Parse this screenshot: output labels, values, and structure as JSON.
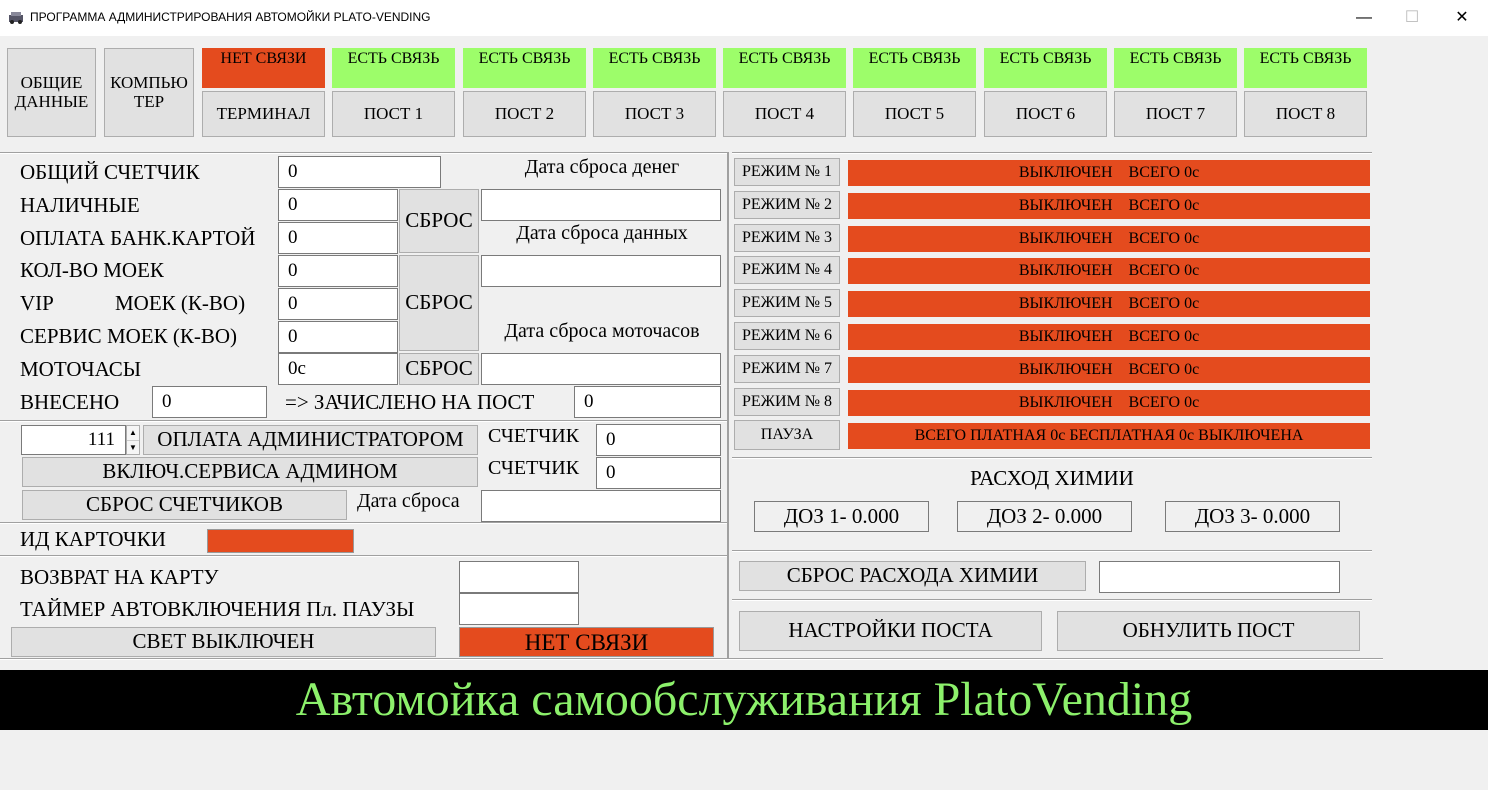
{
  "window": {
    "title": "ПРОГРАММА АДМИНИСТРИРОВАНИЯ АВТОМОЙКИ PLATO-VENDING",
    "minimize": "—",
    "maximize": "☐",
    "close": "✕"
  },
  "top_tabs": {
    "general_line1": "ОБЩИЕ",
    "general_line2": "ДАННЫЕ",
    "computer_line1": "КОМПЬЮ",
    "computer_line2": "ТЕР",
    "units": [
      {
        "status": "НЕТ СВЯЗИ",
        "status_color": "#e44b1e",
        "label": "ТЕРМИНАЛ"
      },
      {
        "status": "ЕСТЬ СВЯЗЬ",
        "status_color": "#9dfd6a",
        "label": "ПОСТ 1"
      },
      {
        "status": "ЕСТЬ СВЯЗЬ",
        "status_color": "#9dfd6a",
        "label": "ПОСТ 2"
      },
      {
        "status": "ЕСТЬ СВЯЗЬ",
        "status_color": "#9dfd6a",
        "label": "ПОСТ 3"
      },
      {
        "status": "ЕСТЬ СВЯЗЬ",
        "status_color": "#9dfd6a",
        "label": "ПОСТ 4"
      },
      {
        "status": "ЕСТЬ СВЯЗЬ",
        "status_color": "#9dfd6a",
        "label": "ПОСТ 5"
      },
      {
        "status": "ЕСТЬ СВЯЗЬ",
        "status_color": "#9dfd6a",
        "label": "ПОСТ 6"
      },
      {
        "status": "ЕСТЬ СВЯЗЬ",
        "status_color": "#9dfd6a",
        "label": "ПОСТ 7"
      },
      {
        "status": "ЕСТЬ СВЯЗЬ",
        "status_color": "#9dfd6a",
        "label": "ПОСТ 8"
      }
    ]
  },
  "counters": {
    "total_label": "ОБЩИЙ СЧЕТЧИК",
    "total_value": "0",
    "cash_label": "НАЛИЧНЫЕ",
    "cash_value": "0",
    "card_label": "ОПЛАТА БАНК.КАРТОЙ",
    "card_value": "0",
    "washes_label": "КОЛ-ВО МОЕК",
    "washes_value": "0",
    "vip_label": "VIP",
    "vip_label2": "МОЕК (К-ВО)",
    "vip_value": "0",
    "service_label": "СЕРВИС МОЕК (К-ВО)",
    "service_value": "0",
    "motohours_label": "МОТОЧАСЫ",
    "motohours_value": "0с",
    "deposited_label": "ВНЕСЕНО",
    "deposited_value": "0",
    "credited_label": "=> ЗАЧИСЛЕНО НА ПОСТ",
    "credited_value": "0",
    "reset_label": "СБРОС",
    "money_reset_date_label": "Дата сброса денег",
    "money_reset_date": "",
    "data_reset_date_label": "Дата сброса данных",
    "data_reset_date": "",
    "motohours_reset_date_label": "Дата сброса моточасов",
    "motohours_reset_date": ""
  },
  "admin": {
    "spinner_value": "111",
    "admin_pay_label": "ОПЛАТА АДМИНИСТРАТОРОМ",
    "service_enable_label": "ВКЛЮЧ.СЕРВИСА АДМИНОМ",
    "reset_counters_label": "СБРОС СЧЕТЧИКОВ",
    "counter_label": "СЧЕТЧИК",
    "counter1_value": "0",
    "counter2_value": "0",
    "reset_date_label": "Дата сброса",
    "reset_date": ""
  },
  "card": {
    "id_label": "ИД КАРТОЧКИ",
    "id_value": ""
  },
  "misc": {
    "refund_label": "ВОЗВРАТ НА КАРТУ",
    "refund_value": "",
    "timer_label": "ТАЙМЕР АВТОВКЛЮЧЕНИЯ Пл. ПАУЗЫ",
    "timer_value": "",
    "light_label": "СВЕТ ВЫКЛЮЧЕН",
    "link_status": "НЕТ СВЯЗИ"
  },
  "modes": [
    {
      "label": "РЕЖИМ № 1",
      "status": "ВЫКЛЮЧЕН    ВСЕГО 0с"
    },
    {
      "label": "РЕЖИМ № 2",
      "status": "ВЫКЛЮЧЕН    ВСЕГО 0с"
    },
    {
      "label": "РЕЖИМ № 3",
      "status": "ВЫКЛЮЧЕН    ВСЕГО 0с"
    },
    {
      "label": "РЕЖИМ № 4",
      "status": "ВЫКЛЮЧЕН    ВСЕГО 0с"
    },
    {
      "label": "РЕЖИМ № 5",
      "status": "ВЫКЛЮЧЕН    ВСЕГО 0с"
    },
    {
      "label": "РЕЖИМ № 6",
      "status": "ВЫКЛЮЧЕН    ВСЕГО 0с"
    },
    {
      "label": "РЕЖИМ № 7",
      "status": "ВЫКЛЮЧЕН    ВСЕГО 0с"
    },
    {
      "label": "РЕЖИМ № 8",
      "status": "ВЫКЛЮЧЕН    ВСЕГО 0с"
    }
  ],
  "pause": {
    "label": "ПАУЗА",
    "status": "ВСЕГО ПЛАТНАЯ 0с БЕСПЛАТНАЯ 0с ВЫКЛЮЧЕНА"
  },
  "chemistry": {
    "title": "РАСХОД ХИМИИ",
    "dose1": "ДОЗ 1- 0.000",
    "dose2": "ДОЗ 2- 0.000",
    "dose3": "ДОЗ 3- 0.000",
    "reset_label": "СБРОС РАСХОДА ХИМИИ",
    "reset_value": ""
  },
  "post_actions": {
    "settings_label": "НАСТРОЙКИ ПОСТА",
    "zero_label": "ОБНУЛИТЬ ПОСТ"
  },
  "banner": {
    "text": "Автомойка самообслуживания PlatoVending"
  },
  "colors": {
    "red": "#e44b1e",
    "green": "#9dfd6a",
    "banner_text": "#8cf06b"
  }
}
